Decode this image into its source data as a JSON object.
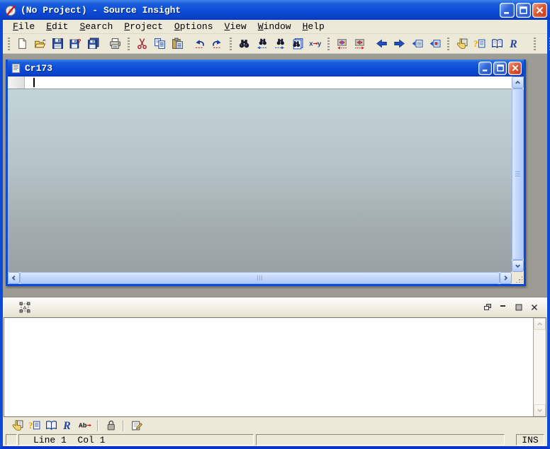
{
  "window": {
    "title": "(No Project) - Source Insight"
  },
  "menubar": {
    "items": [
      "File",
      "Edit",
      "Search",
      "Project",
      "Options",
      "View",
      "Window",
      "Help"
    ]
  },
  "toolbar": {
    "icons": [
      "new-file",
      "open-file",
      "save",
      "save-as",
      "save-all",
      "print",
      "cut",
      "copy",
      "paste",
      "undo",
      "redo",
      "find",
      "find-previous",
      "find-next",
      "search-in-files",
      "replace",
      "jump-to-previous-link",
      "jump-to-next-link",
      "go-back",
      "go-forward",
      "go-to-previous-item",
      "go-to-next-item",
      "browse-symbols",
      "context-window",
      "help-book",
      "relation-window"
    ]
  },
  "document_window": {
    "title": "Cr173"
  },
  "panel": {
    "name": "relation-window",
    "toolbar_icons": [
      "browse-symbols",
      "context-window",
      "help-book",
      "relation-window",
      "rename",
      "lock",
      "properties"
    ]
  },
  "statusbar": {
    "line_col": "Line 1  Col 1",
    "mode": "INS"
  },
  "colors": {
    "titlebar_blue": "#0B4BD8",
    "xp_face": "#ECE9D8",
    "mdi_gray": "#9C9C94",
    "editor_gradient_top": "#C3D4D7",
    "editor_gradient_bottom": "#98A2A4"
  }
}
